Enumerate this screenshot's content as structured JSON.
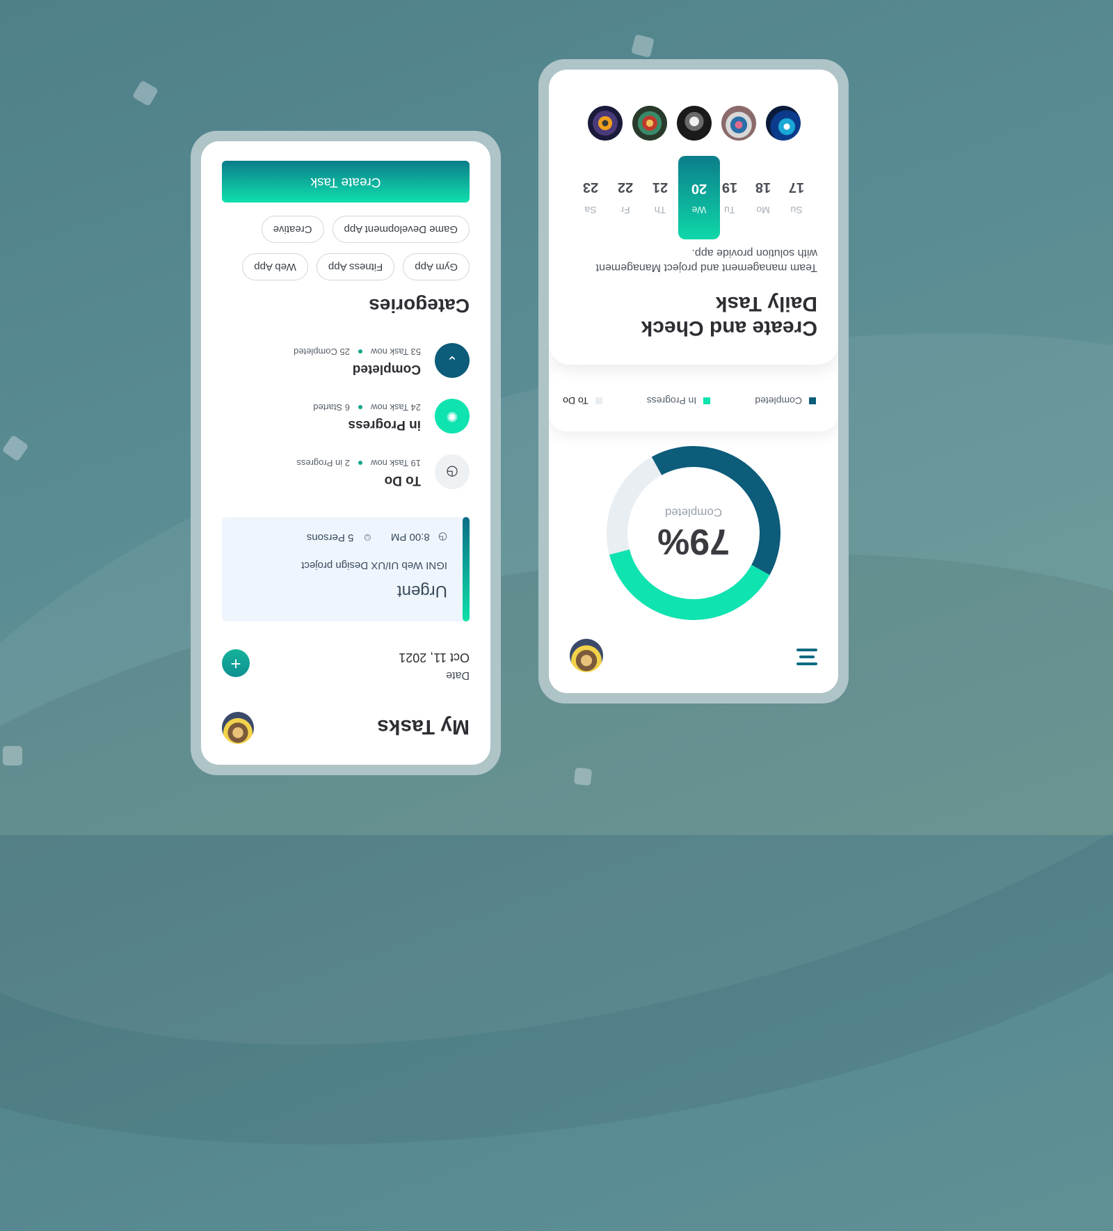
{
  "left_screen": {
    "header": {
      "title": "My Tasks"
    },
    "date": {
      "label": "Date",
      "value": "Oct 11, 2021",
      "add_label": "+"
    },
    "urgent_card": {
      "title": "Urgent",
      "description": "IGNI Web UI/UX Design project",
      "time": "8:00 PM",
      "persons": "5 Persons"
    },
    "statuses": [
      {
        "title": "To Do",
        "tasks": "19 Task now",
        "detail": "2 in Progress",
        "icon": "clock-icon"
      },
      {
        "title": "in Progress",
        "tasks": "24 Task now",
        "detail": "6 Started",
        "icon": "spinner-icon"
      },
      {
        "title": "Completed",
        "tasks": "53 Task now",
        "detail": "25 Completed",
        "icon": "chevron-up-icon"
      }
    ],
    "categories": {
      "title": "Categories",
      "chips": [
        "Gym App",
        "Fitness App",
        "Web App",
        "Game Development App",
        "Creative"
      ]
    },
    "create_task_label": "Create Task"
  },
  "right_screen": {
    "donut": {
      "percent_label": "79%",
      "caption": "Completed",
      "completed": 0.41,
      "in_progress": 0.38
    },
    "legend": [
      {
        "label": "To Do",
        "color": "#e9eef3"
      },
      {
        "label": "In Progress",
        "color": "#0fe3b0"
      },
      {
        "label": "Completed",
        "color": "#0c5c7a"
      }
    ],
    "card": {
      "title": "Create and Check Daily Task",
      "description": "Team management and project Management with solution provide app."
    },
    "days": [
      {
        "name": "Su",
        "num": "17"
      },
      {
        "name": "Mo",
        "num": "18"
      },
      {
        "name": "Tu",
        "num": "19"
      },
      {
        "name": "We",
        "num": "20",
        "active": true
      },
      {
        "name": "Th",
        "num": "21"
      },
      {
        "name": "Fr",
        "num": "22"
      },
      {
        "name": "Sa",
        "num": "23"
      }
    ]
  },
  "colors": {
    "accent": "#0fe3b0",
    "brand_dark": "#0c5c7a",
    "background": "#5a8c94"
  }
}
